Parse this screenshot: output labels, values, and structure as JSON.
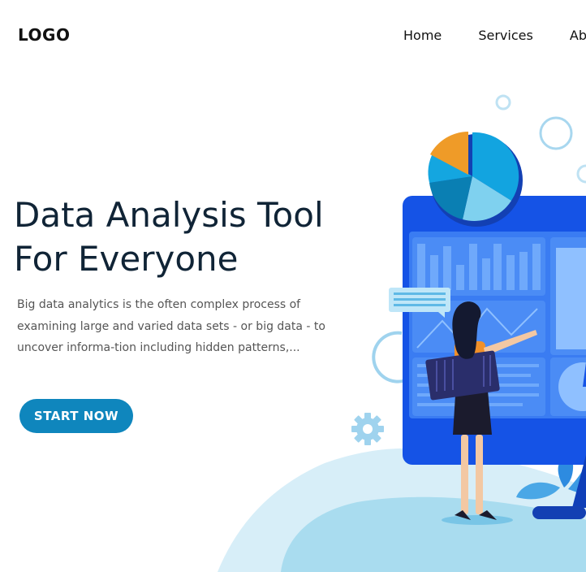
{
  "header": {
    "logo": "LOGO",
    "nav": [
      {
        "label": "Home"
      },
      {
        "label": "Services"
      },
      {
        "label": "Abo"
      }
    ]
  },
  "hero": {
    "title_line1": "Data Analysis Tool",
    "title_line2": "For Everyone",
    "description": "Big data analytics is the often complex process of examining large and varied data sets - or big data - to uncover informa-tion including hidden patterns,...",
    "cta_label": "START NOW"
  },
  "illustration": {
    "icons": [
      "pie-chart-icon",
      "gear-icon",
      "monitor-dashboard-icon",
      "person-icon",
      "plant-icon"
    ]
  },
  "colors": {
    "primary": "#0f86bd",
    "monitor": "#1553e6",
    "blob": "#a9dcef",
    "title": "#102436"
  }
}
